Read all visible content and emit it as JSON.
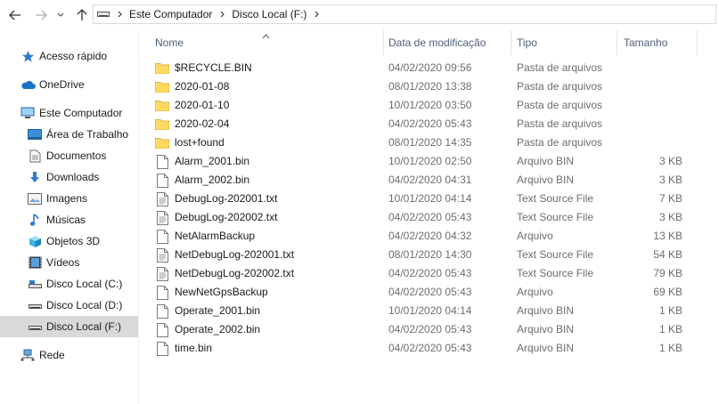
{
  "nav": {
    "breadcrumbs": [
      "Este Computador",
      "Disco Local (F:)"
    ]
  },
  "sidebar": {
    "items": [
      {
        "label": "Acesso rápido",
        "icon": "star-icon"
      },
      {
        "label": "OneDrive",
        "icon": "cloud-icon"
      },
      {
        "label": "Este Computador",
        "icon": "computer-icon"
      },
      {
        "label": "Área de Trabalho",
        "icon": "desktop-icon"
      },
      {
        "label": "Documentos",
        "icon": "document-icon"
      },
      {
        "label": "Downloads",
        "icon": "download-icon"
      },
      {
        "label": "Imagens",
        "icon": "image-icon"
      },
      {
        "label": "Músicas",
        "icon": "music-icon"
      },
      {
        "label": "Objetos 3D",
        "icon": "cube-icon"
      },
      {
        "label": "Vídeos",
        "icon": "video-icon"
      },
      {
        "label": "Disco Local (C:)",
        "icon": "drive-icon"
      },
      {
        "label": "Disco Local (D:)",
        "icon": "drive-icon"
      },
      {
        "label": "Disco Local (F:)",
        "icon": "drive-icon",
        "selected": true
      },
      {
        "label": "Rede",
        "icon": "network-icon"
      }
    ]
  },
  "columns": {
    "name": "Nome",
    "date": "Data de modificação",
    "type": "Tipo",
    "size": "Tamanho"
  },
  "files": [
    {
      "name": "$RECYCLE.BIN",
      "date": "04/02/2020 09:56",
      "type": "Pasta de arquivos",
      "size": "",
      "kind": "folder"
    },
    {
      "name": "2020-01-08",
      "date": "08/01/2020 13:38",
      "type": "Pasta de arquivos",
      "size": "",
      "kind": "folder"
    },
    {
      "name": "2020-01-10",
      "date": "10/01/2020 03:50",
      "type": "Pasta de arquivos",
      "size": "",
      "kind": "folder"
    },
    {
      "name": "2020-02-04",
      "date": "04/02/2020 05:43",
      "type": "Pasta de arquivos",
      "size": "",
      "kind": "folder"
    },
    {
      "name": "lost+found",
      "date": "08/01/2020 14:35",
      "type": "Pasta de arquivos",
      "size": "",
      "kind": "folder"
    },
    {
      "name": "Alarm_2001.bin",
      "date": "10/01/2020 02:50",
      "type": "Arquivo BIN",
      "size": "3 KB",
      "kind": "file"
    },
    {
      "name": "Alarm_2002.bin",
      "date": "04/02/2020 04:31",
      "type": "Arquivo BIN",
      "size": "3 KB",
      "kind": "file"
    },
    {
      "name": "DebugLog-202001.txt",
      "date": "10/01/2020 04:14",
      "type": "Text Source File",
      "size": "7 KB",
      "kind": "text"
    },
    {
      "name": "DebugLog-202002.txt",
      "date": "04/02/2020 05:43",
      "type": "Text Source File",
      "size": "3 KB",
      "kind": "text"
    },
    {
      "name": "NetAlarmBackup",
      "date": "04/02/2020 04:32",
      "type": "Arquivo",
      "size": "13 KB",
      "kind": "file"
    },
    {
      "name": "NetDebugLog-202001.txt",
      "date": "08/01/2020 14:30",
      "type": "Text Source File",
      "size": "54 KB",
      "kind": "text"
    },
    {
      "name": "NetDebugLog-202002.txt",
      "date": "04/02/2020 05:43",
      "type": "Text Source File",
      "size": "79 KB",
      "kind": "text"
    },
    {
      "name": "NewNetGpsBackup",
      "date": "04/02/2020 05:43",
      "type": "Arquivo",
      "size": "69 KB",
      "kind": "file"
    },
    {
      "name": "Operate_2001.bin",
      "date": "10/01/2020 04:14",
      "type": "Arquivo BIN",
      "size": "1 KB",
      "kind": "file"
    },
    {
      "name": "Operate_2002.bin",
      "date": "04/02/2020 05:43",
      "type": "Arquivo BIN",
      "size": "1 KB",
      "kind": "file"
    },
    {
      "name": "time.bin",
      "date": "04/02/2020 05:43",
      "type": "Arquivo BIN",
      "size": "1 KB",
      "kind": "file"
    }
  ]
}
